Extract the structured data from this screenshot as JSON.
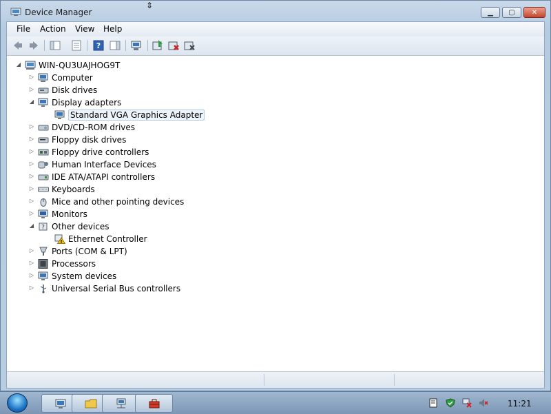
{
  "window": {
    "title": "Device Manager",
    "caption_buttons": [
      "minimize",
      "maximize",
      "close"
    ]
  },
  "menu": [
    {
      "label": "File"
    },
    {
      "label": "Action"
    },
    {
      "label": "View"
    },
    {
      "label": "Help"
    }
  ],
  "toolbar": {
    "buttons": [
      "back-icon",
      "forward-icon",
      "show-hide-console-tree-icon",
      "properties-icon",
      "help-icon",
      "action-pane-icon",
      "scan-hardware-icon",
      "update-driver-icon",
      "uninstall-icon",
      "disable-icon"
    ]
  },
  "tree": {
    "root": "WIN-QU3UAJHOG9T",
    "items": [
      {
        "label": "Computer",
        "icon": "computer-icon",
        "expanded": false
      },
      {
        "label": "Disk drives",
        "icon": "disk-drive-icon",
        "expanded": false
      },
      {
        "label": "Display adapters",
        "icon": "display-icon",
        "expanded": true,
        "children": [
          {
            "label": "Standard VGA Graphics Adapter",
            "icon": "display-adapter-icon",
            "selected": true
          }
        ]
      },
      {
        "label": "DVD/CD-ROM drives",
        "icon": "dvd-drive-icon",
        "expanded": false
      },
      {
        "label": "Floppy disk drives",
        "icon": "floppy-icon",
        "expanded": false
      },
      {
        "label": "Floppy drive controllers",
        "icon": "floppy-controller-icon",
        "expanded": false
      },
      {
        "label": "Human Interface Devices",
        "icon": "hid-icon",
        "expanded": false
      },
      {
        "label": "IDE ATA/ATAPI controllers",
        "icon": "ide-controller-icon",
        "expanded": false
      },
      {
        "label": "Keyboards",
        "icon": "keyboard-icon",
        "expanded": false
      },
      {
        "label": "Mice and other pointing devices",
        "icon": "mouse-icon",
        "expanded": false
      },
      {
        "label": "Monitors",
        "icon": "monitor-icon",
        "expanded": false
      },
      {
        "label": "Other devices",
        "icon": "unknown-device-icon",
        "expanded": true,
        "children": [
          {
            "label": "Ethernet Controller",
            "icon": "warning-device-icon",
            "selected": false
          }
        ]
      },
      {
        "label": "Ports (COM & LPT)",
        "icon": "port-icon",
        "expanded": false
      },
      {
        "label": "Processors",
        "icon": "processor-icon",
        "expanded": false
      },
      {
        "label": "System devices",
        "icon": "system-device-icon",
        "expanded": false
      },
      {
        "label": "Universal Serial Bus controllers",
        "icon": "usb-icon",
        "expanded": false
      }
    ]
  },
  "taskbar": {
    "buttons": [
      "server-manager-icon",
      "explorer-folder-icon",
      "network-icon",
      "toolbox-icon"
    ],
    "tray": [
      "action-center-icon",
      "security-icon",
      "network-disconnected-icon",
      "volume-muted-icon"
    ],
    "clock": "11:21"
  },
  "colors": {
    "accent": "#1e74c7",
    "selection": "#eef4fb",
    "selection_border": "#b3c9e1",
    "close_button": "#c5452d"
  }
}
